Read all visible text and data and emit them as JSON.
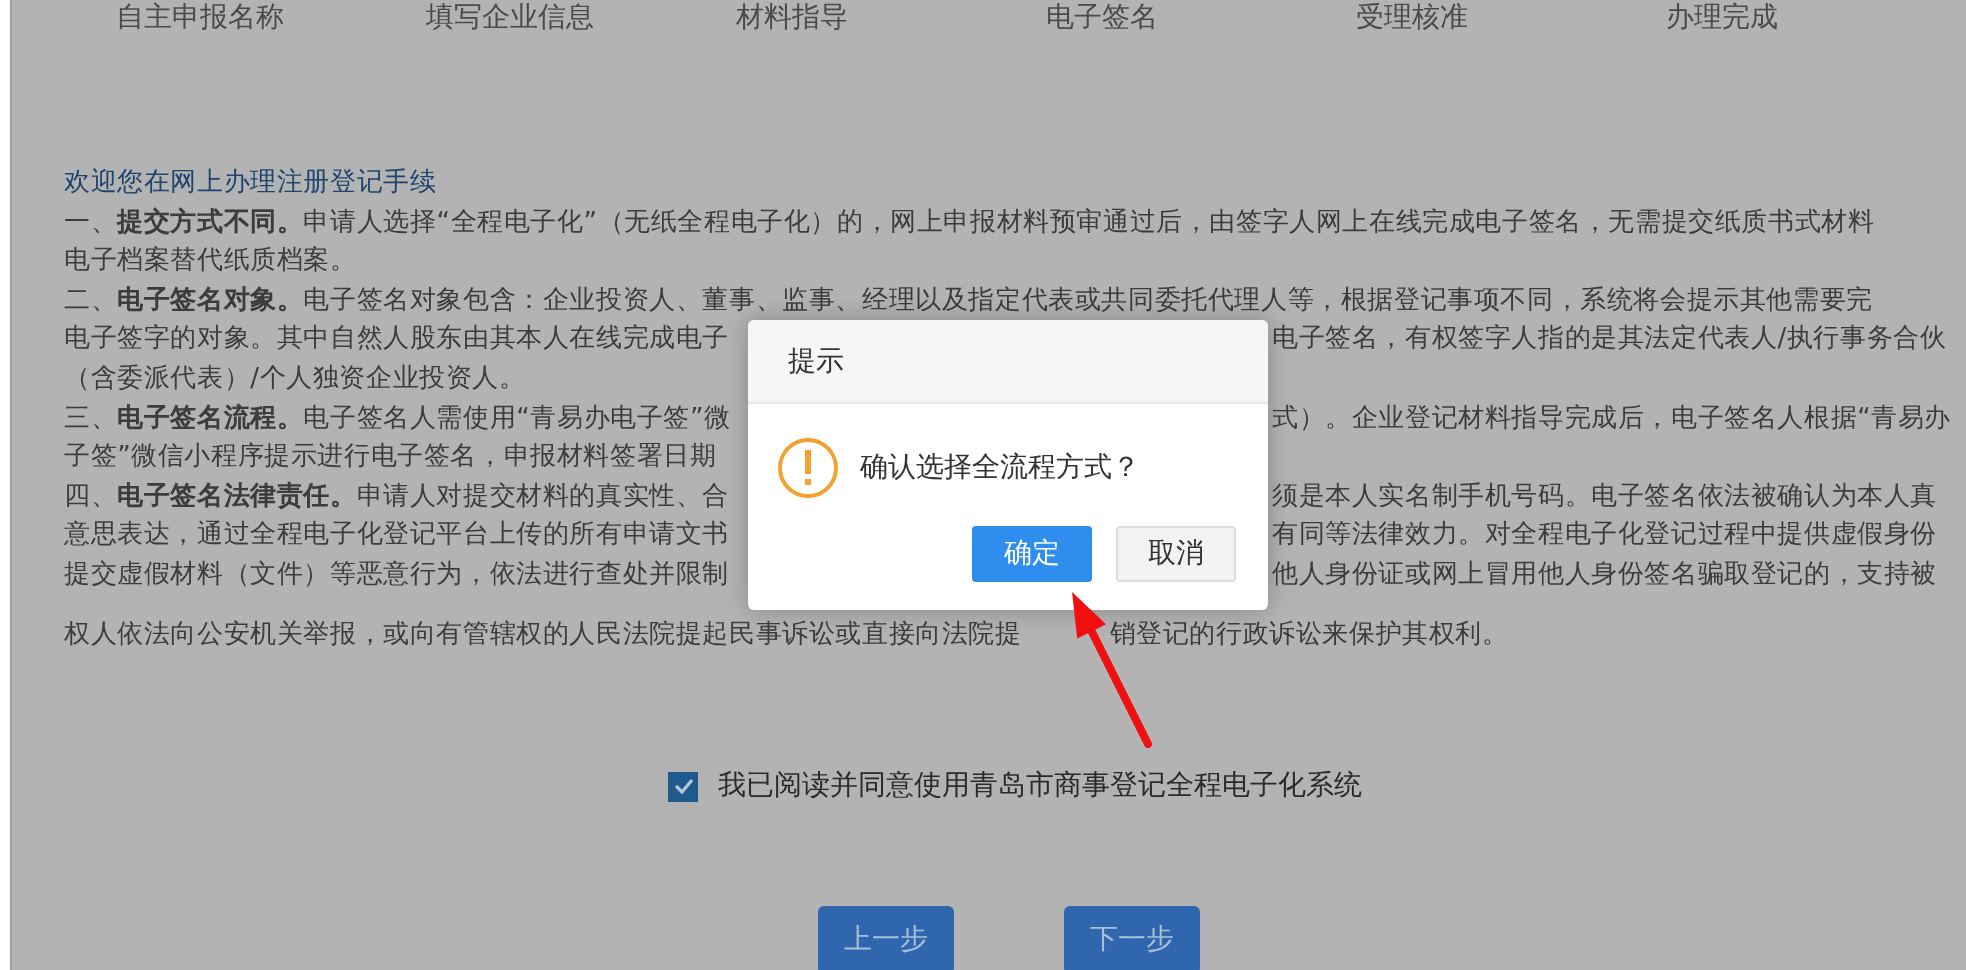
{
  "steps": [
    "自主申报名称",
    "填写企业信息",
    "材料指导",
    "电子签名",
    "受理核准",
    "办理完成"
  ],
  "notice": {
    "title": "欢迎您在网上办理注册登记手续",
    "lines": [
      {
        "left": "一、**提交方式不同。**申请人选择“全程电子化”（无纸全程电子化）的，网上申报材料预审通过后，由签字人网上在线完成电子签名，无需提交纸质书式材料"
      },
      {
        "left": "电子档案替代纸质档案。"
      },
      {
        "left": "二、**电子签名对象。**电子签名对象包含：企业投资人、董事、监事、经理以及指定代表或共同委托代理人等，根据登记事项不同，系统将会提示其他需要完"
      },
      {
        "left": "电子签字的对象。其中自然人股东由其本人在线完成电子",
        "right": "电子签名，有权签字人指的是其法定代表人/执行事务合伙"
      },
      {
        "left": "（含委派代表）/个人独资企业投资人。"
      },
      {
        "left": "三、**电子签名流程。**电子签名人需使用“青易办电子签”微",
        "right": "式）。企业登记材料指导完成后，电子签名人根据“青易办"
      },
      {
        "left": "子签”微信小程序提示进行电子签名，申报材料签署日期"
      },
      {
        "left": "四、**电子签名法律责任。**申请人对提交材料的真实性、合",
        "right": "须是本人实名制手机号码。电子签名依法被确认为本人真"
      },
      {
        "left": "意思表达，通过全程电子化登记平台上传的所有申请文书",
        "right": "有同等法律效力。对全程电子化登记过程中提供虚假身份"
      },
      {
        "left": "提交虚假材料（文件）等恶意行为，依法进行查处并限制",
        "right": "他人身份证或网上冒用他人身份签名骗取登记的，支持被"
      },
      {
        "left": "权人依法向公安机关举报，或向有管辖权的人民法院提起民事诉讼或直接向法院提",
        "right": "销登记的行政诉讼来保护其权利。",
        "kind": "gap"
      }
    ]
  },
  "agreement": {
    "checked": true,
    "label": "我已阅读并同意使用青岛市商事登记全程电子化系统"
  },
  "buttons": [
    {
      "label": "上一步"
    },
    {
      "label": "下一步"
    }
  ],
  "dialog": {
    "title": "提示",
    "message": "确认选择全流程方式？",
    "buttons": [
      {
        "label": "确定",
        "kind": "primary"
      },
      {
        "label": "取消",
        "kind": "default"
      }
    ]
  }
}
